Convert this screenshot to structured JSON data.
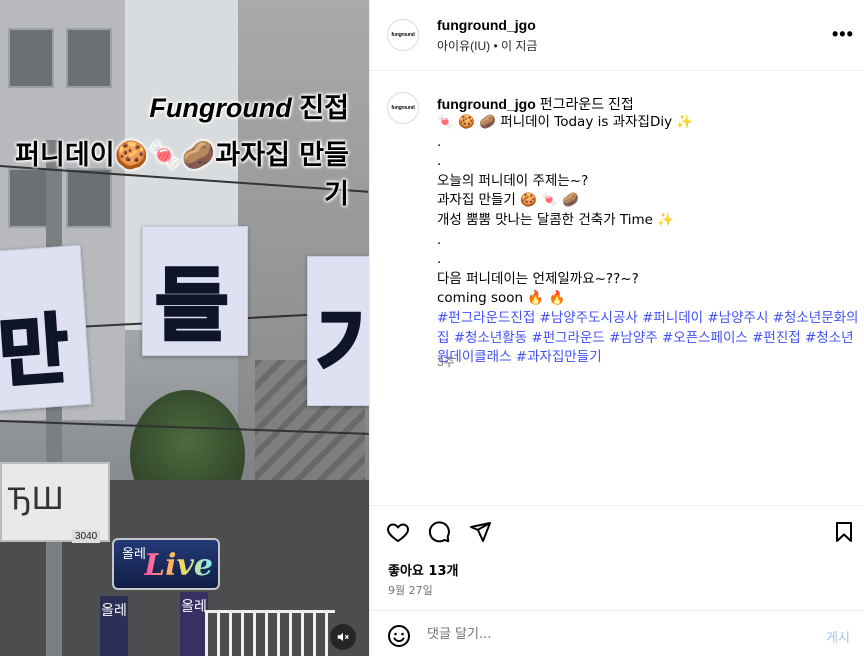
{
  "media": {
    "overlay_line1_brand": "Funground",
    "overlay_line1_rest": "진접",
    "overlay_line2": "퍼니데이🍪🍬🥔과자집 만들기",
    "card_glyphs": [
      "만",
      "들",
      "기"
    ],
    "shop_sign_text": "ЂШ",
    "shop_number": "3040",
    "live_sign_top": "올레",
    "live_sign_main": "Live",
    "vertical_signs": [
      "올레",
      "올레"
    ],
    "mute_icon": "speaker-muted-icon"
  },
  "header": {
    "username": "funground_jgo",
    "audio": "아이유(IU)",
    "separator": "•",
    "time": "이 지금",
    "avatar_text": "funground",
    "more_label": "•••"
  },
  "caption": {
    "username": "funground_jgo",
    "title": "펀그라운드 진접",
    "lines": [
      "🍬 🍪 🥔 퍼니데이 Today is 과자집Diy ✨",
      ".",
      ".",
      "오늘의 퍼니데이 주제는~?",
      "과자집 만들기 🍪 🍬 🥔",
      "개성 뿜뿜 맛나는 달콤한 건축가 Time ✨",
      ".",
      ".",
      "다음 퍼니데이는 언제일까요~??~?",
      "coming soon 🔥 🔥"
    ],
    "hashtags": "#펀그라운드진접 #남양주도시공사 #퍼니데이 #남양주시 #청소년문화의집 #청소년활동 #펀그라운드 #남양주 #오픈스페이스 #펀진접 #청소년원데이클래스 #과자집만들기",
    "age": "3주"
  },
  "actions": {
    "like_icon": "heart-icon",
    "comment_icon": "comment-icon",
    "share_icon": "paper-plane-icon",
    "save_icon": "bookmark-icon",
    "likes_text": "좋아요 13개",
    "date": "9월 27일"
  },
  "comment": {
    "emoji_icon": "smiley-icon",
    "placeholder": "댓글 달기...",
    "post_label": "게시"
  }
}
